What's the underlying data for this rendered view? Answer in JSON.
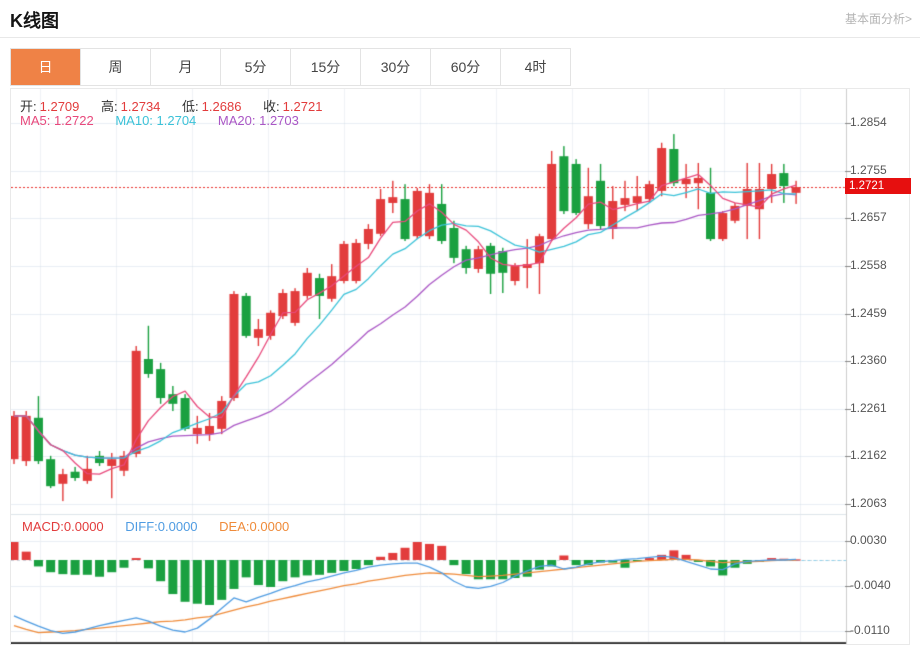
{
  "header": {
    "title": "K线图",
    "analysis_link": "基本面分析>"
  },
  "tabs": {
    "items": [
      "日",
      "周",
      "月",
      "5分",
      "15分",
      "30分",
      "60分",
      "4时"
    ],
    "names": [
      "day",
      "week",
      "month",
      "5min",
      "15min",
      "30min",
      "60min",
      "4hour"
    ],
    "selected": 0
  },
  "ohlc_legend": {
    "open_label": "开:",
    "open": "1.2709",
    "high_label": "高:",
    "high": "1.2734",
    "low_label": "低:",
    "low": "1.2686",
    "close_label": "收:",
    "close": "1.2721"
  },
  "ma_legend": {
    "ma5": "MA5: 1.2722",
    "ma10": "MA10: 1.2704",
    "ma20": "MA20: 1.2703"
  },
  "macd_legend": {
    "macd": "MACD:0.0000",
    "diff": "DIFF:0.0000",
    "dea": "DEA:0.0000"
  },
  "price_axis": {
    "ticks": [
      "1.2854",
      "1.2755",
      "1.2657",
      "1.2558",
      "1.2459",
      "1.2360",
      "1.2261",
      "1.2162",
      "1.2063"
    ],
    "last_price": "1.2721"
  },
  "macd_axis": {
    "ticks": [
      "0.0030",
      "-0.0040",
      "-0.0110"
    ]
  },
  "colors": {
    "up": "#e23c3c",
    "down": "#1aa040",
    "ma5": "#e8497c",
    "ma10": "#3bc2d8",
    "ma20": "#aa57c5",
    "diff": "#4f9ce2",
    "dea": "#ef8b3a",
    "dotted_line": "#e8302d",
    "badge": "#e60f0f",
    "tab_active": "#ef8246",
    "grid": "#e9eef4",
    "axis": "#cccccc",
    "label_text": "#333333",
    "tick_text": "#555555"
  },
  "chart_data": {
    "type": "candlestick+macd",
    "main": {
      "ylim": [
        1.2063,
        1.2854
      ],
      "y_ticks": [
        1.2854,
        1.2755,
        1.2657,
        1.2558,
        1.2459,
        1.236,
        1.2261,
        1.2162,
        1.2063
      ],
      "last_price": 1.2721,
      "ma_periods": [
        5,
        10,
        20
      ],
      "candles_format": [
        "open",
        "high",
        "low",
        "close"
      ],
      "candles": [
        [
          1.2156,
          1.2256,
          1.2146,
          1.2246
        ],
        [
          1.2152,
          1.2256,
          1.2142,
          1.2246
        ],
        [
          1.2242,
          1.2287,
          1.2146,
          1.2152
        ],
        [
          1.2156,
          1.2163,
          1.2096,
          1.21
        ],
        [
          1.2105,
          1.2136,
          1.2069,
          1.2125
        ],
        [
          1.213,
          1.214,
          1.2111,
          1.2117
        ],
        [
          1.2111,
          1.2163,
          1.2105,
          1.2136
        ],
        [
          1.2163,
          1.2173,
          1.2142,
          1.2148
        ],
        [
          1.2142,
          1.2169,
          1.2075,
          1.2156
        ],
        [
          1.2132,
          1.2173,
          1.2121,
          1.2163
        ],
        [
          1.2167,
          1.2391,
          1.216,
          1.2381
        ],
        [
          1.2364,
          1.2433,
          1.2325,
          1.2333
        ],
        [
          1.2343,
          1.2356,
          1.2271,
          1.2283
        ],
        [
          1.2291,
          1.2308,
          1.2256,
          1.2271
        ],
        [
          1.2283,
          1.2291,
          1.2215,
          1.2219
        ],
        [
          1.2208,
          1.2246,
          1.2188,
          1.2221
        ],
        [
          1.2208,
          1.2252,
          1.2194,
          1.2225
        ],
        [
          1.2219,
          1.2287,
          1.2208,
          1.2277
        ],
        [
          1.2283,
          1.2505,
          1.2277,
          1.2499
        ],
        [
          1.2495,
          1.2501,
          1.2408,
          1.2412
        ],
        [
          1.2408,
          1.2447,
          1.2391,
          1.2426
        ],
        [
          1.2412,
          1.2465,
          1.2404,
          1.246
        ],
        [
          1.2453,
          1.2509,
          1.2447,
          1.2501
        ],
        [
          1.2439,
          1.2511,
          1.2433,
          1.2505
        ],
        [
          1.2495,
          1.2553,
          1.2489,
          1.2543
        ],
        [
          1.2532,
          1.2541,
          1.2447,
          1.2495
        ],
        [
          1.2489,
          1.2561,
          1.2483,
          1.2536
        ],
        [
          1.2526,
          1.2609,
          1.2521,
          1.2603
        ],
        [
          1.2526,
          1.2613,
          1.2521,
          1.2605
        ],
        [
          1.2603,
          1.2644,
          1.2592,
          1.2634
        ],
        [
          1.2624,
          1.2717,
          1.2619,
          1.2696
        ],
        [
          1.2688,
          1.2734,
          1.2667,
          1.27
        ],
        [
          1.2696,
          1.2727,
          1.2609,
          1.2613
        ],
        [
          1.2619,
          1.2719,
          1.2613,
          1.2713
        ],
        [
          1.2619,
          1.2727,
          1.2613,
          1.2709
        ],
        [
          1.2686,
          1.2727,
          1.2603,
          1.2609
        ],
        [
          1.2636,
          1.2651,
          1.2563,
          1.2574
        ],
        [
          1.2592,
          1.2599,
          1.2541,
          1.2553
        ],
        [
          1.2551,
          1.2599,
          1.2543,
          1.2592
        ],
        [
          1.2599,
          1.2605,
          1.2499,
          1.2541
        ],
        [
          1.2588,
          1.2595,
          1.2501,
          1.2543
        ],
        [
          1.2526,
          1.2563,
          1.2517,
          1.2557
        ],
        [
          1.2553,
          1.2613,
          1.2511,
          1.2561
        ],
        [
          1.2563,
          1.2624,
          1.2499,
          1.2619
        ],
        [
          1.2613,
          1.2796,
          1.2609,
          1.2769
        ],
        [
          1.2785,
          1.2806,
          1.2665,
          1.2671
        ],
        [
          1.2769,
          1.2779,
          1.2663,
          1.2667
        ],
        [
          1.2644,
          1.2761,
          1.2634,
          1.2702
        ],
        [
          1.2734,
          1.2769,
          1.2634,
          1.264
        ],
        [
          1.2634,
          1.2723,
          1.2613,
          1.2692
        ],
        [
          1.2684,
          1.2734,
          1.2671,
          1.2698
        ],
        [
          1.2688,
          1.2744,
          1.2671,
          1.2702
        ],
        [
          1.2696,
          1.2734,
          1.2688,
          1.2727
        ],
        [
          1.2713,
          1.2813,
          1.2702,
          1.2802
        ],
        [
          1.28,
          1.2831,
          1.2723,
          1.2729
        ],
        [
          1.2727,
          1.2769,
          1.2698,
          1.2738
        ],
        [
          1.2729,
          1.2771,
          1.2675,
          1.274
        ],
        [
          1.2709,
          1.2761,
          1.2609,
          1.2613
        ],
        [
          1.2613,
          1.2671,
          1.2609,
          1.2667
        ],
        [
          1.2651,
          1.2688,
          1.2646,
          1.2682
        ],
        [
          1.2682,
          1.2771,
          1.2613,
          1.2717
        ],
        [
          1.2675,
          1.2771,
          1.2613,
          1.2717
        ],
        [
          1.2717,
          1.2769,
          1.2688,
          1.2748
        ],
        [
          1.275,
          1.2769,
          1.2688,
          1.2723
        ],
        [
          1.2709,
          1.2734,
          1.2686,
          1.2721
        ]
      ]
    },
    "macd": {
      "y_ticks": [
        0.003,
        -0.004,
        -0.011
      ],
      "hist": [
        0.0028,
        0.0013,
        -0.001,
        -0.0019,
        -0.0022,
        -0.0023,
        -0.0023,
        -0.0026,
        -0.0019,
        -0.0012,
        0.0003,
        -0.0013,
        -0.0033,
        -0.0053,
        -0.0065,
        -0.0068,
        -0.007,
        -0.0062,
        -0.0045,
        -0.0027,
        -0.0039,
        -0.0042,
        -0.0033,
        -0.0027,
        -0.0024,
        -0.0023,
        -0.002,
        -0.0017,
        -0.0014,
        -0.0008,
        0.0005,
        0.0011,
        0.0019,
        0.0028,
        0.0025,
        0.0022,
        -0.0008,
        -0.0022,
        -0.003,
        -0.003,
        -0.003,
        -0.0028,
        -0.0026,
        -0.0015,
        -0.001,
        0.0007,
        -0.0008,
        -0.0008,
        -0.0004,
        -0.0004,
        -0.0012,
        -0.0001,
        0.0003,
        0.0008,
        0.0015,
        0.0008,
        -0.0003,
        -0.001,
        -0.0024,
        -0.0012,
        -0.0006,
        -0.0003,
        0.0003,
        0.0002,
        0.0001
      ],
      "diff": [
        -0.0087,
        -0.0095,
        -0.0103,
        -0.011,
        -0.0114,
        -0.0112,
        -0.0107,
        -0.0102,
        -0.0098,
        -0.0094,
        -0.009,
        -0.0095,
        -0.0103,
        -0.0109,
        -0.0112,
        -0.0106,
        -0.0092,
        -0.0075,
        -0.0059,
        -0.0065,
        -0.0058,
        -0.0052,
        -0.0045,
        -0.004,
        -0.0034,
        -0.003,
        -0.0025,
        -0.002,
        -0.0016,
        -0.0011,
        -0.0008,
        -0.0006,
        -0.0005,
        -0.0005,
        -0.0011,
        -0.002,
        -0.0033,
        -0.0042,
        -0.0044,
        -0.0041,
        -0.0035,
        -0.0025,
        -0.0017,
        -0.001,
        -0.0008,
        -0.0014,
        -0.0011,
        -0.0006,
        -0.0003,
        -0.0001,
        0.0001,
        0.0002,
        0.0004,
        0.0006,
        0.0004,
        -0.0002,
        -0.0008,
        -0.0014,
        -0.0015,
        -0.0006,
        -0.0002,
        -0.0001,
        0.0,
        0.0,
        0.0001
      ],
      "dea": [
        -0.0102,
        -0.0108,
        -0.0113,
        -0.0112,
        -0.0111,
        -0.011,
        -0.0108,
        -0.0106,
        -0.0104,
        -0.0102,
        -0.01,
        -0.0098,
        -0.0096,
        -0.0095,
        -0.0093,
        -0.009,
        -0.0088,
        -0.0083,
        -0.0078,
        -0.0073,
        -0.0069,
        -0.0064,
        -0.006,
        -0.0056,
        -0.0052,
        -0.0048,
        -0.0044,
        -0.004,
        -0.0037,
        -0.0033,
        -0.003,
        -0.0027,
        -0.0024,
        -0.0022,
        -0.002,
        -0.0021,
        -0.0022,
        -0.0024,
        -0.0026,
        -0.0025,
        -0.0024,
        -0.0022,
        -0.002,
        -0.0018,
        -0.0016,
        -0.0014,
        -0.0012,
        -0.001,
        -0.0008,
        -0.0006,
        -0.0004,
        -0.0002,
        -0.0001,
        0.0,
        0.0001,
        0.0001,
        0.0,
        -0.0002,
        -0.0004,
        -0.0003,
        -0.0003,
        -0.0002,
        -0.0001,
        0.0,
        0.0
      ]
    }
  }
}
